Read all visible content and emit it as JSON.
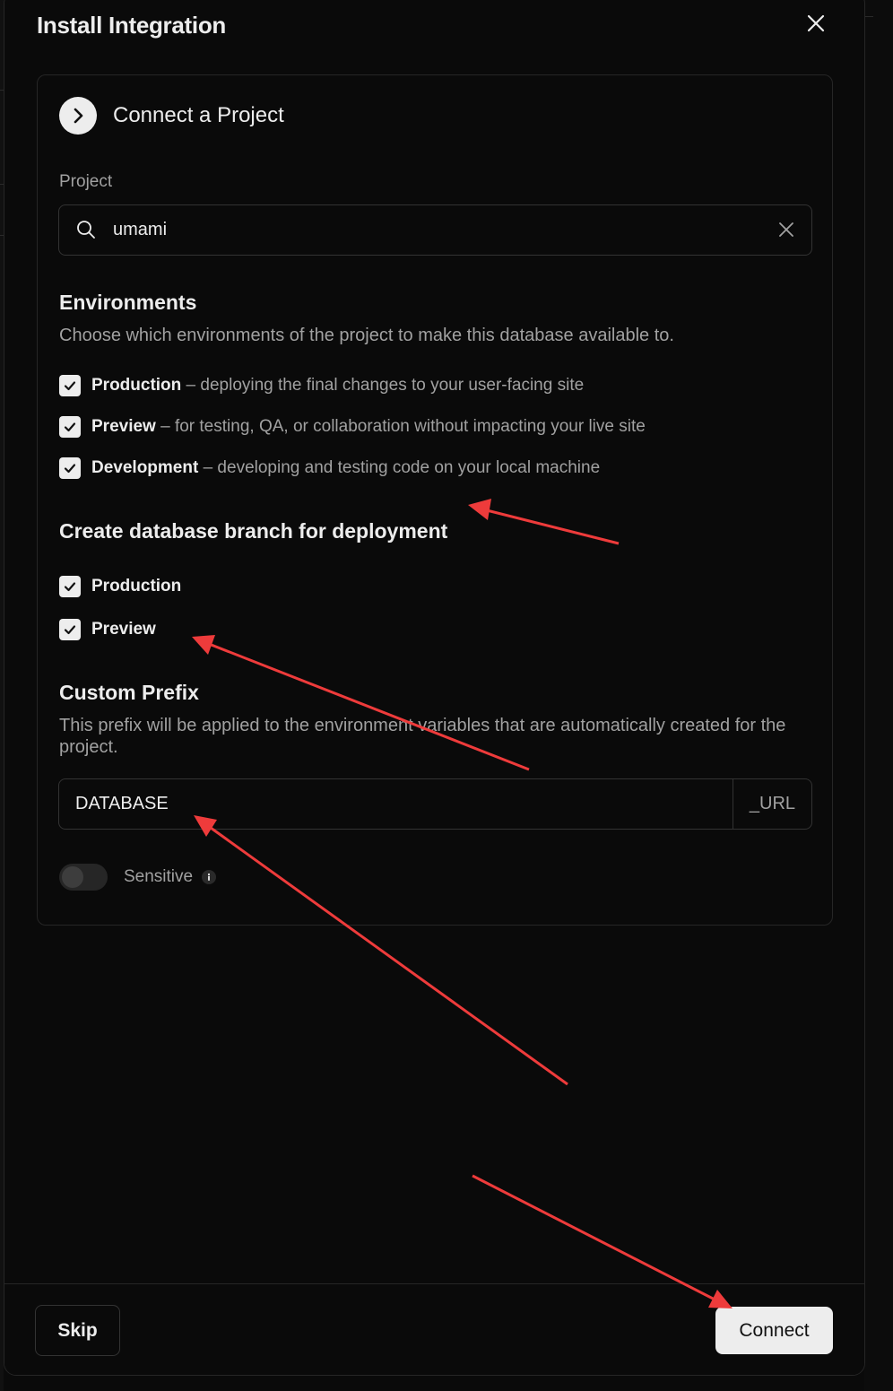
{
  "modal": {
    "title": "Install Integration"
  },
  "step": {
    "title": "Connect a Project"
  },
  "project": {
    "label": "Project",
    "value": "umami"
  },
  "environments": {
    "title": "Environments",
    "description": "Choose which environments of the project to make this database available to.",
    "items": [
      {
        "name": "Production",
        "desc": " – deploying the final changes to your user-facing site",
        "checked": true
      },
      {
        "name": "Preview",
        "desc": " – for testing, QA, or collaboration without impacting your live site",
        "checked": true
      },
      {
        "name": "Development",
        "desc": " – developing and testing code on your local machine",
        "checked": true
      }
    ]
  },
  "branch": {
    "title": "Create database branch for deployment",
    "items": [
      {
        "name": "Production",
        "checked": true
      },
      {
        "name": "Preview",
        "checked": true
      }
    ]
  },
  "prefix": {
    "title": "Custom Prefix",
    "description": "This prefix will be applied to the environment variables that are automatically created for the project.",
    "value": "DATABASE",
    "suffix": "_URL"
  },
  "sensitive": {
    "label": "Sensitive",
    "enabled": false
  },
  "footer": {
    "skip_label": "Skip",
    "connect_label": "Connect"
  },
  "colors": {
    "annotation_arrow": "#ee3b3b",
    "primary_button": "#ededed",
    "background": "#0a0a0a"
  },
  "icons": [
    "close-icon",
    "chevron-right-icon",
    "search-icon",
    "clear-icon",
    "check-icon",
    "info-icon"
  ]
}
